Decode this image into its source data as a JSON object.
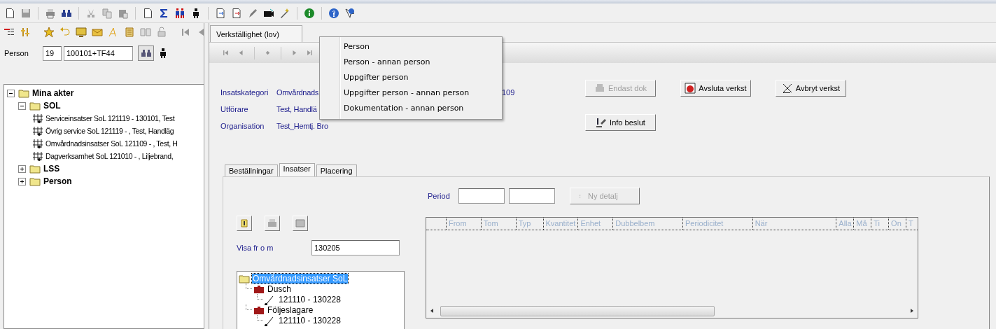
{
  "left_panel": {
    "person": {
      "label": "Person",
      "number": "19",
      "id": "100101+TF44"
    },
    "tree": [
      {
        "label": "Mina akter",
        "kind": "folder",
        "expanded": true,
        "children": [
          {
            "label": "SOL",
            "kind": "folder",
            "expanded": true,
            "children": [
              {
                "label": "Serviceinsatser SoL 121119 - 130101, Test",
                "kind": "case"
              },
              {
                "label": "Övrig service SoL 121119 - , Test, Handläg",
                "kind": "case"
              },
              {
                "label": "Omvårdnadsinsatser SoL 121109 - , Test, H",
                "kind": "case"
              },
              {
                "label": "Dagverksamhet SoL 121010 - , Liljebrand,",
                "kind": "case"
              }
            ]
          },
          {
            "label": "LSS",
            "kind": "folder",
            "expanded": false
          },
          {
            "label": "Person",
            "kind": "folder",
            "expanded": false
          }
        ]
      }
    ]
  },
  "document_tab": {
    "label": "Verkställighet (lov)"
  },
  "details": [
    {
      "label": "Insatskategori",
      "value": "Omvårdnads",
      "value_end": "109"
    },
    {
      "label": "Utförare",
      "value": "Test, Handlä"
    },
    {
      "label": "Organisation",
      "value": "Test_Hemtj. Bro"
    }
  ],
  "action_buttons": [
    [
      {
        "label": "Endast dok",
        "disabled": true
      },
      {
        "label": "Avsluta verkst",
        "disabled": false
      },
      {
        "label": "Avbryt verkst",
        "disabled": false
      }
    ],
    [
      {
        "label": "Info beslut",
        "disabled": false
      }
    ]
  ],
  "context_menu": {
    "items": [
      "Person",
      "Person - annan person",
      "Uppgifter person",
      "Uppgifter person - annan person",
      "Dokumentation - annan person"
    ]
  },
  "sub_tabs": [
    {
      "label": "Beställningar",
      "selected": false
    },
    {
      "label": "Insatser",
      "selected": true
    },
    {
      "label": "Placering",
      "selected": false
    }
  ],
  "period": {
    "label": "Period"
  },
  "new_detail_button": {
    "label": "Ny detalj",
    "disabled": true
  },
  "show_from": {
    "label": "Visa fr o m",
    "value": "130205"
  },
  "insats_tree": [
    {
      "label": "Omvårdnadsinsatser SoL",
      "kind": "folder",
      "selected": true,
      "children": [
        {
          "label": "Dusch",
          "kind": "case",
          "selected": false,
          "children": [
            {
              "label": "121110 - 130228",
              "kind": "period",
              "selected": false
            }
          ]
        },
        {
          "label": "Följeslagare",
          "kind": "case",
          "selected": false,
          "children": [
            {
              "label": "121110 - 130228",
              "kind": "period",
              "selected": false
            }
          ]
        }
      ]
    }
  ],
  "grid": {
    "columns": [
      "From",
      "Tom",
      "Typ",
      "Kvantitet",
      "Enhet",
      "Dubbelbem",
      "Periodicitet",
      "När",
      "Alla",
      "Må",
      "Ti",
      "On",
      "T"
    ]
  }
}
